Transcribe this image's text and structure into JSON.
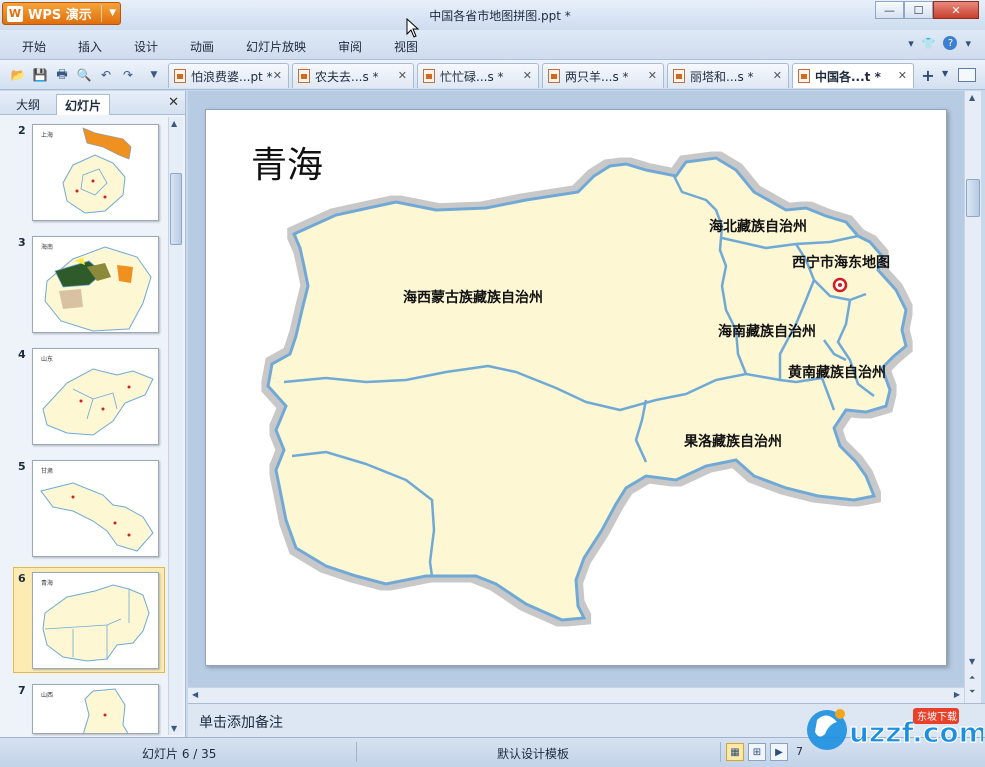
{
  "app": {
    "name": "WPS 演示",
    "window_title": "中国各省市地图拼图.ppt *"
  },
  "menu": [
    "开始",
    "插入",
    "设计",
    "动画",
    "幻灯片放映",
    "审阅",
    "视图"
  ],
  "doc_tabs": [
    {
      "label": "怕浪费婆...pt *",
      "active": false
    },
    {
      "label": "农夫去...s *",
      "active": false
    },
    {
      "label": "忙忙碌...s *",
      "active": false
    },
    {
      "label": "两只羊...s *",
      "active": false
    },
    {
      "label": "丽塔和...s *",
      "active": false
    },
    {
      "label": "中国各...t *",
      "active": true
    }
  ],
  "left_pane": {
    "tabs": [
      "大纲",
      "幻灯片"
    ],
    "active_tab": "幻灯片",
    "thumbnails": [
      {
        "num": "2",
        "label": "上海"
      },
      {
        "num": "3",
        "label": "海南"
      },
      {
        "num": "4",
        "label": "山东"
      },
      {
        "num": "5",
        "label": "甘肃"
      },
      {
        "num": "6",
        "label": "青海",
        "selected": true
      },
      {
        "num": "7",
        "label": "山西"
      }
    ]
  },
  "slide": {
    "title": "青海",
    "regions": [
      "海西蒙古族藏族自治州",
      "海北藏族自治州",
      "西宁市海东地图",
      "海南藏族自治州",
      "黄南藏族自治州",
      "果洛藏族自治州"
    ],
    "map_fill": "#fdf7d4",
    "map_border": "#6fa9d6",
    "map_outline": "#c8c8c8"
  },
  "notes_placeholder": "单击添加备注",
  "status": {
    "slide_info": "幻灯片 6 / 35",
    "template": "默认设计模板",
    "zoom": "7"
  },
  "watermark": {
    "brand": "uzzf.com",
    "badge": "东坡下载"
  },
  "colors": {
    "accent_orange": "#e8861f",
    "chrome_blue": "#c9d9ec",
    "selection": "#fcecb4"
  }
}
